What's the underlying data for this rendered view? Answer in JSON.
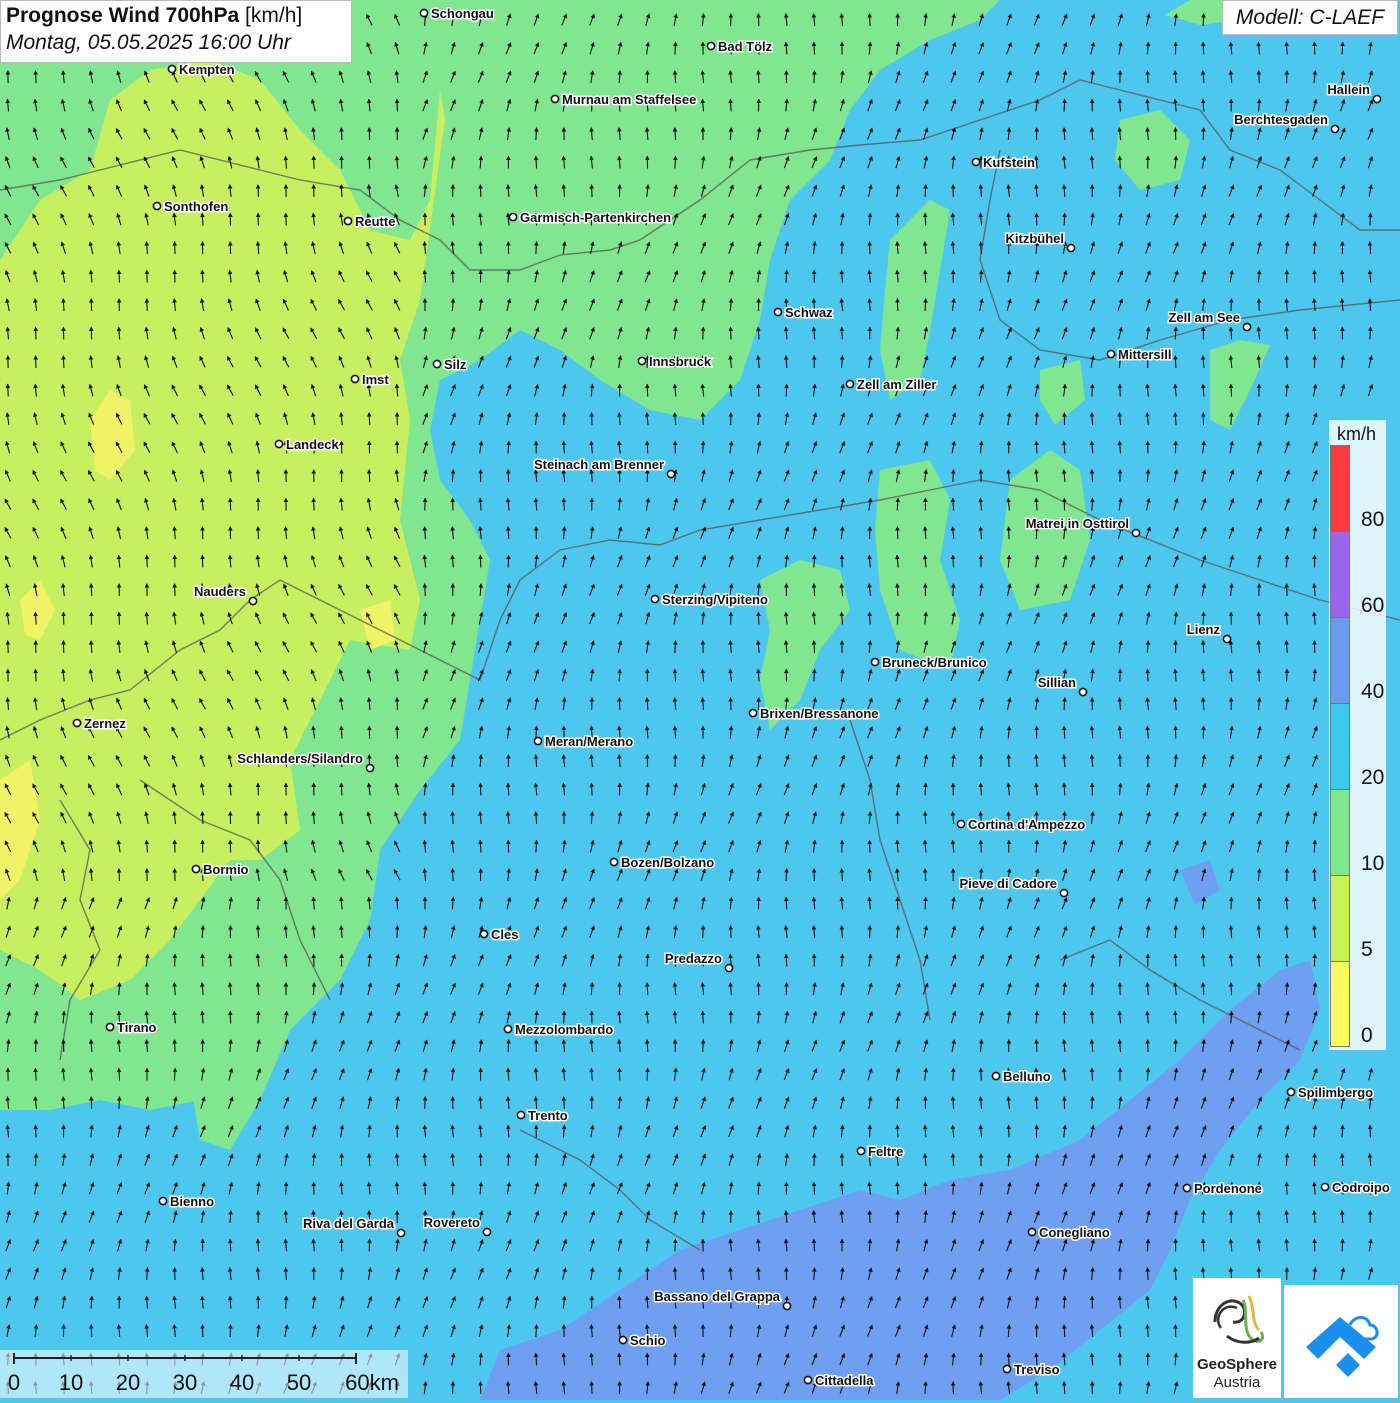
{
  "header": {
    "title_main": "Prognose Wind 700hPa",
    "title_unit": "[km/h]",
    "datetime": "Montag, 05.05.2025 16:00 Uhr",
    "model": "Modell: C-LAEF"
  },
  "legend": {
    "unit": "km/h",
    "labels": [
      "80",
      "60",
      "40",
      "20",
      "10",
      "5",
      "0"
    ],
    "colors": [
      "#f83c3c",
      "#9a66ec",
      "#6b9bee",
      "#3ec8ef",
      "#7fe88c",
      "#c6f35a",
      "#fbfb62"
    ]
  },
  "scale_bar": {
    "labels": [
      "0",
      "10",
      "20",
      "30",
      "40",
      "50",
      "60km"
    ]
  },
  "logos": {
    "geosphere_line1": "GeoSphere",
    "geosphere_line2": "Austria"
  },
  "cities": [
    {
      "name": "Schongau"
    },
    {
      "name": "Bad Tölz"
    },
    {
      "name": "Kempten"
    },
    {
      "name": "Murnau am Staffelsee"
    },
    {
      "name": "Hallein"
    },
    {
      "name": "Berchtesgaden"
    },
    {
      "name": "Kufstein"
    },
    {
      "name": "Sonthofen"
    },
    {
      "name": "Reutte"
    },
    {
      "name": "Garmisch-Partenkirchen"
    },
    {
      "name": "Kitzbühel"
    },
    {
      "name": "Schwaz"
    },
    {
      "name": "Zell am See"
    },
    {
      "name": "Mittersill"
    },
    {
      "name": "Silz"
    },
    {
      "name": "Innsbruck"
    },
    {
      "name": "Imst"
    },
    {
      "name": "Zell am Ziller"
    },
    {
      "name": "Landeck"
    },
    {
      "name": "Steinach am Brenner"
    },
    {
      "name": "Matrei in Osttirol"
    },
    {
      "name": "Nauders"
    },
    {
      "name": "Sterzing/Vipiteno"
    },
    {
      "name": "Lienz"
    },
    {
      "name": "Bruneck/Brunico"
    },
    {
      "name": "Sillian"
    },
    {
      "name": "Zernez"
    },
    {
      "name": "Brixen/Bressanone"
    },
    {
      "name": "Meran/Merano"
    },
    {
      "name": "Schlanders/Silandro"
    },
    {
      "name": "Cortina d'Ampezzo"
    },
    {
      "name": "Bozen/Bolzano"
    },
    {
      "name": "Bormio"
    },
    {
      "name": "Pieve di Cadore"
    },
    {
      "name": "Cles"
    },
    {
      "name": "Predazzo"
    },
    {
      "name": "Tirano"
    },
    {
      "name": "Mezzolombardo"
    },
    {
      "name": "Belluno"
    },
    {
      "name": "Spilimbergo"
    },
    {
      "name": "Trento"
    },
    {
      "name": "Feltre"
    },
    {
      "name": "Pordenone"
    },
    {
      "name": "Codroipo"
    },
    {
      "name": "Bienno"
    },
    {
      "name": "Riva del Garda"
    },
    {
      "name": "Rovereto"
    },
    {
      "name": "Conegliano"
    },
    {
      "name": "Bassano del Grappa"
    },
    {
      "name": "Schio"
    },
    {
      "name": "Treviso"
    },
    {
      "name": "Cittadella"
    }
  ]
}
